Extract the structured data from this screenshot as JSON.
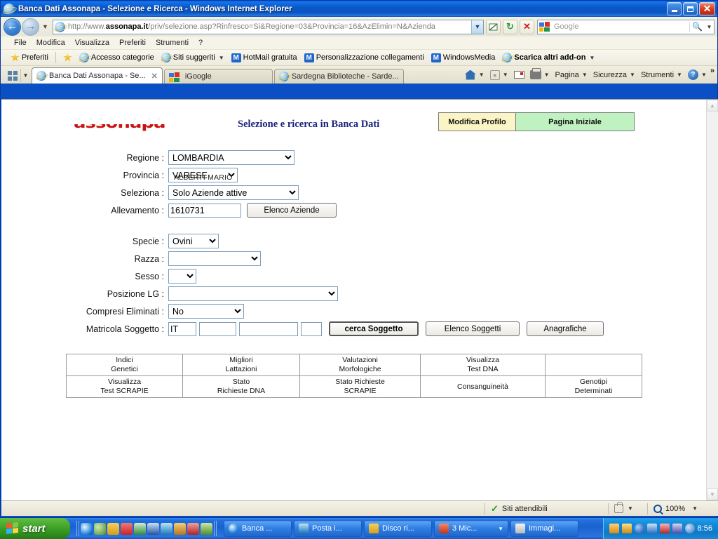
{
  "window": {
    "title": "Banca Dati Assonapa - Selezione e Ricerca - Windows Internet Explorer",
    "minimize_label": "Riduci a icona",
    "maximize_label": "Ripristina",
    "close_label": "Chiudi"
  },
  "address": {
    "url_prefix": "http://www.",
    "url_domain": "assonapa.it",
    "url_suffix": "/priv/selezione.asp?Rinfresco=Si&Regione=03&Provincia=16&AzElimin=N&Azienda",
    "search_placeholder": "Google",
    "back_label": "Indietro",
    "forward_label": "Avanti",
    "compat_label": "Visualizzazione compatibilita",
    "refresh_label": "Aggiorna",
    "stop_label": "Interrompi"
  },
  "menu": {
    "items": [
      {
        "label": "File"
      },
      {
        "label": "Modifica"
      },
      {
        "label": "Visualizza"
      },
      {
        "label": "Preferiti"
      },
      {
        "label": "Strumenti"
      },
      {
        "label": "?"
      }
    ]
  },
  "favorites_bar": {
    "button_label": "Preferiti",
    "items": [
      {
        "label": "Accesso categorie",
        "icon": "ie-icon",
        "caret": false,
        "bold": false
      },
      {
        "label": "Siti suggeriti",
        "icon": "ie-icon",
        "caret": true,
        "bold": false
      },
      {
        "label": "HotMail gratuita",
        "icon": "msn-icon",
        "caret": false,
        "bold": false
      },
      {
        "label": "Personalizzazione collegamenti",
        "icon": "msn-icon",
        "caret": false,
        "bold": false
      },
      {
        "label": "WindowsMedia",
        "icon": "msn-icon",
        "caret": false,
        "bold": false
      },
      {
        "label": "Scarica altri add-on",
        "icon": "ie-icon",
        "caret": true,
        "bold": true
      }
    ]
  },
  "tabs": [
    {
      "label": "Banca Dati Assonapa - Se...",
      "active": true
    },
    {
      "label": "iGoogle",
      "active": false
    },
    {
      "label": "Sardegna Biblioteche - Sarde...",
      "active": false
    }
  ],
  "command_bar": {
    "items": [
      {
        "label": "Pagina"
      },
      {
        "label": "Sicurezza"
      },
      {
        "label": "Strumenti"
      }
    ],
    "home_label": "Pagina iniziale",
    "feeds_label": "Feed",
    "mail_label": "Posta",
    "print_label": "Stampa",
    "help_label": "Guida",
    "overflow": "»"
  },
  "page": {
    "logo_text": "assonapa",
    "title": "Selezione e ricerca in Banca Dati",
    "header_buttons": [
      {
        "label": "Modifica Profilo",
        "color": "#fbf4c4"
      },
      {
        "label": "Pagina Iniziale",
        "color": "#bff2c0"
      }
    ],
    "form": {
      "regione": {
        "label": "Regione :",
        "value": "LOMBARDIA",
        "options": [
          "LOMBARDIA"
        ]
      },
      "provincia": {
        "label": "Provincia :",
        "value": "VARESE",
        "options": [
          "VARESE"
        ]
      },
      "seleziona": {
        "label": "Seleziona :",
        "value": "Solo Aziende attive",
        "options": [
          "Solo Aziende attive"
        ]
      },
      "allevamento": {
        "label": "Allevamento :",
        "value": "1610731",
        "button": "Elenco Aziende"
      },
      "allevamento_name": "ALBERTI MARIO",
      "specie": {
        "label": "Specie :",
        "value": "Ovini",
        "options": [
          "Ovini"
        ]
      },
      "razza": {
        "label": "Razza :",
        "value": "",
        "options": [
          ""
        ]
      },
      "sesso": {
        "label": "Sesso :",
        "value": "",
        "options": [
          ""
        ]
      },
      "posizione_lg": {
        "label": "Posizione LG :",
        "value": "",
        "options": [
          ""
        ]
      },
      "compresi_eliminati": {
        "label": "Compresi Eliminati :",
        "value": "No",
        "options": [
          "No"
        ]
      },
      "matricola": {
        "label": "Matricola Soggetto :",
        "part1": "IT",
        "part2": "",
        "part3": "",
        "part4": "",
        "buttons": [
          {
            "label": "cerca Soggetto",
            "primary": true
          },
          {
            "label": "Elenco Soggetti",
            "primary": false
          },
          {
            "label": "Anagrafiche",
            "primary": false
          }
        ]
      }
    },
    "link_table": {
      "rows": [
        [
          {
            "line1": "Indici",
            "line2": "Genetici"
          },
          {
            "line1": "Migliori",
            "line2": "Lattazioni"
          },
          {
            "line1": "Valutazioni",
            "line2": "Morfologiche"
          },
          {
            "line1": "Visualizza",
            "line2": "Test DNA"
          },
          {
            "line1": "",
            "line2": ""
          }
        ],
        [
          {
            "line1": "Visualizza",
            "line2": "Test SCRAPIE"
          },
          {
            "line1": "Stato",
            "line2": "Richieste DNA"
          },
          {
            "line1": "Stato Richieste",
            "line2": "SCRAPIE"
          },
          {
            "line1": "Consanguineità",
            "line2": ""
          },
          {
            "line1": "Genotipi",
            "line2": "Determinati"
          }
        ]
      ]
    }
  },
  "status_bar": {
    "zone": "Siti attendibili",
    "zoom": "100%"
  },
  "taskbar": {
    "start_label": "start",
    "tasks": [
      {
        "label": "Banca ...",
        "color": "#e8f4ff",
        "dropdown": false
      },
      {
        "label": "Posta i...",
        "color": "#9fd6f5",
        "dropdown": false
      },
      {
        "label": "Disco ri...",
        "color": "#f5c44a",
        "dropdown": false
      },
      {
        "label": "3 Mic...",
        "color": "#e8502e",
        "dropdown": true
      },
      {
        "label": "Immagi...",
        "color": "#e0e0e0",
        "dropdown": false
      }
    ],
    "clock": "8:56"
  }
}
